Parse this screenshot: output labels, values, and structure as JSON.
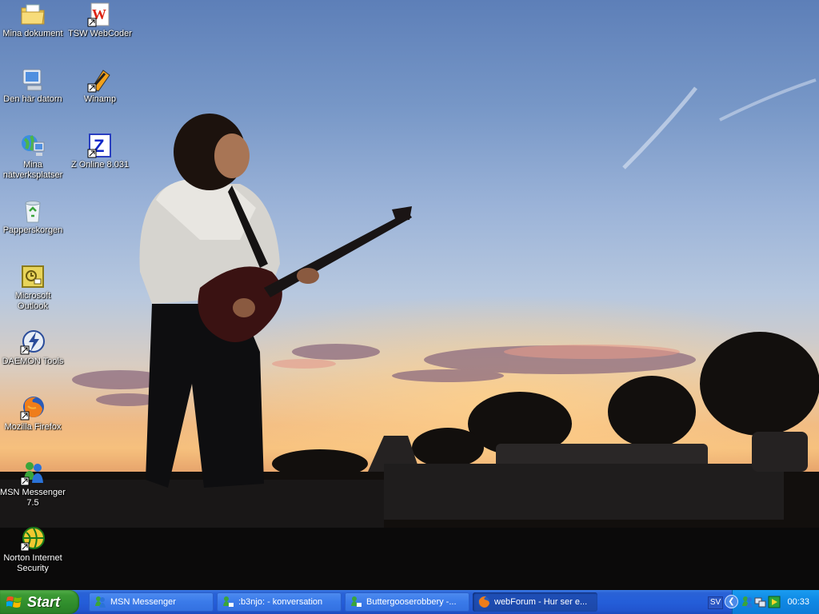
{
  "desktop": {
    "icons": [
      {
        "label": "Mina dokument",
        "icon": "my-documents-folder-icon",
        "shortcut": false
      },
      {
        "label": "TSW WebCoder",
        "icon": "tsw-webcoder-icon",
        "shortcut": true
      },
      {
        "label": "Den här datorn",
        "icon": "my-computer-icon",
        "shortcut": false
      },
      {
        "label": "Winamp",
        "icon": "winamp-icon",
        "shortcut": true
      },
      {
        "label": "Mina nätverksplatser",
        "icon": "network-places-icon",
        "shortcut": false
      },
      {
        "label": "Z Online 8.031",
        "icon": "z-online-icon",
        "shortcut": true
      },
      {
        "label": "Papperskorgen",
        "icon": "recycle-bin-icon",
        "shortcut": false
      },
      {
        "label": "Microsoft Outlook",
        "icon": "outlook-icon",
        "shortcut": false
      },
      {
        "label": "DAEMON Tools",
        "icon": "daemon-tools-icon",
        "shortcut": true
      },
      {
        "label": "Mozilla Firefox",
        "icon": "firefox-icon",
        "shortcut": true
      },
      {
        "label": "MSN Messenger 7.5",
        "icon": "msn-messenger-icon",
        "shortcut": true
      },
      {
        "label": "Norton Internet Security",
        "icon": "norton-icon",
        "shortcut": true
      }
    ]
  },
  "taskbar": {
    "start_label": "Start",
    "tasks": [
      {
        "label": "MSN Messenger",
        "icon": "msn-buddy-icon",
        "active": false
      },
      {
        "label": ":b3njo: - konversation",
        "icon": "msn-conversation-icon",
        "active": false
      },
      {
        "label": "Buttergooserobbery -...",
        "icon": "msn-conversation-icon",
        "active": false
      },
      {
        "label": "webForum - Hur ser e...",
        "icon": "firefox-icon",
        "active": true
      }
    ],
    "language": "SV",
    "clock": "00:33"
  },
  "colors": {
    "taskbar_blue": "#245ed9",
    "start_green": "#3c9a34",
    "tray_blue": "#0f8ae6"
  }
}
